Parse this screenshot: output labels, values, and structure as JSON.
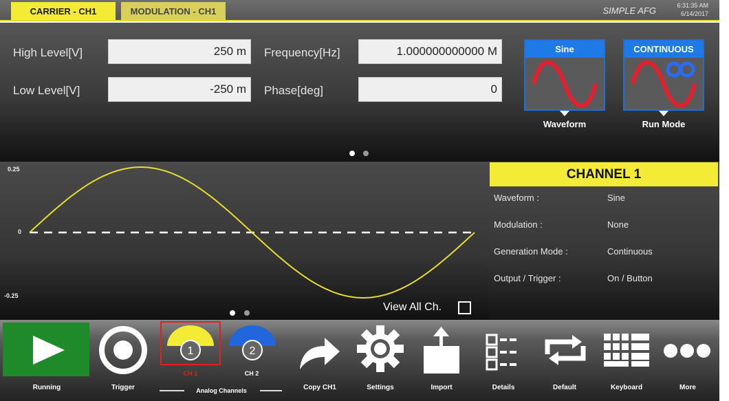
{
  "tabs": {
    "carrier": "CARRIER - CH1",
    "modulation": "MODULATION - CH1"
  },
  "header": {
    "app_title": "SIMPLE AFG",
    "time": "6:31:35 AM",
    "date": "6/14/2017"
  },
  "params": {
    "high_level": {
      "label": "High Level[V]",
      "value": "250 m"
    },
    "low_level": {
      "label": "Low Level[V]",
      "value": "-250 m"
    },
    "frequency": {
      "label": "Frequency[Hz]",
      "value": "1.000000000000 M"
    },
    "phase": {
      "label": "Phase[deg]",
      "value": "0"
    }
  },
  "waveform_card": {
    "title": "Sine",
    "caption": "Waveform",
    "icon": "sine-wave-icon"
  },
  "runmode_card": {
    "title": "CONTINUOUS",
    "caption": "Run Mode",
    "icon": "infinity-icon"
  },
  "plot": {
    "y_top": "0.25",
    "y_mid": "0",
    "y_bottom": "-0.25",
    "trace_color": "#e8dc2c",
    "view_all_label": "View All Ch.",
    "view_all_checked": false
  },
  "channel": {
    "title": "CHANNEL 1",
    "rows": [
      {
        "key": "Waveform :",
        "value": "Sine"
      },
      {
        "key": "Modulation :",
        "value": "None"
      },
      {
        "key": "Generation Mode :",
        "value": "Continuous"
      },
      {
        "key": "Output / Trigger :",
        "value": "On / Button"
      }
    ]
  },
  "toolbar": {
    "running": "Running",
    "trigger": "Trigger",
    "ch1_number": "1",
    "ch1_label": "CH 1",
    "ch2_number": "2",
    "ch2_label": "CH 2",
    "analog_channels": "Analog Channels",
    "copy": "Copy CH1",
    "settings": "Settings",
    "import": "Import",
    "details": "Details",
    "default": "Default",
    "keyboard": "Keyboard",
    "more": "More"
  },
  "colors": {
    "accent_yellow": "#f3eb35",
    "card_blue": "#1e7ae6",
    "run_green": "#1f8a2a",
    "ch2_blue": "#2266dd",
    "selection_red": "#e02020"
  }
}
